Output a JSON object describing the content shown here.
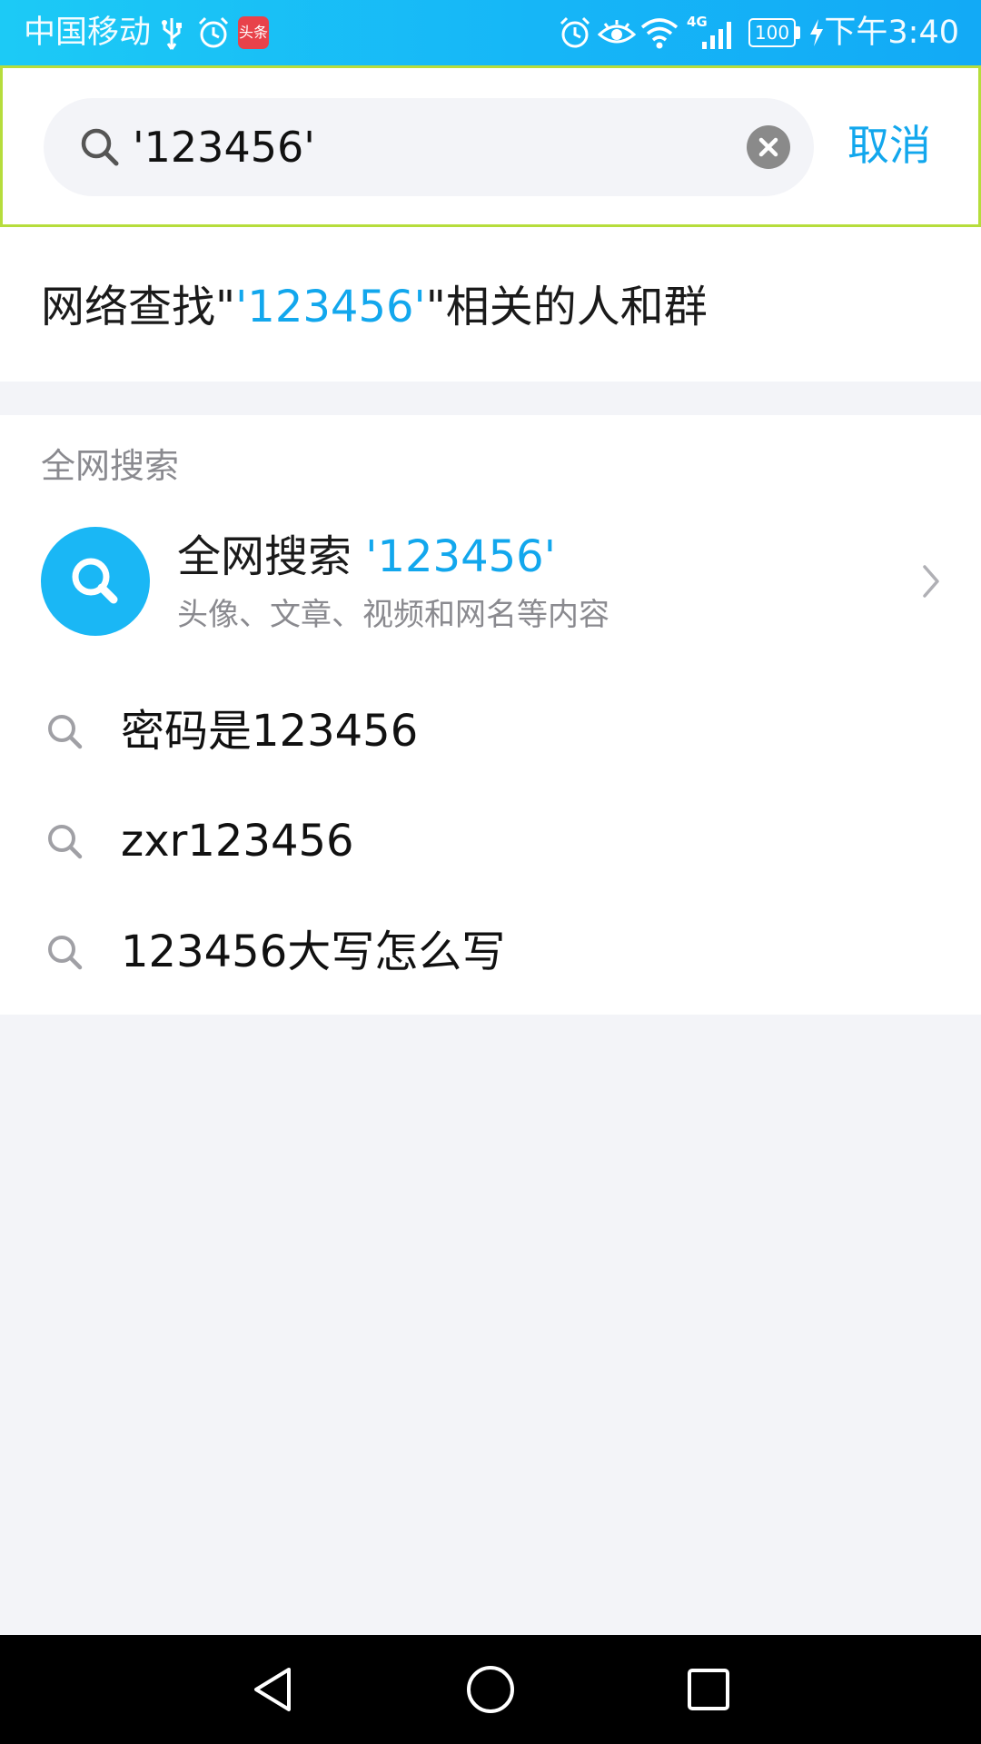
{
  "status_bar": {
    "carrier": "中国移动",
    "network_type": "4G",
    "battery": "100",
    "time": "下午3:40",
    "app_badge_text": "头条"
  },
  "search": {
    "query": "'123456'",
    "cancel_label": "取消"
  },
  "network_find": {
    "prefix": "网络查找\"",
    "keyword": "'123456'",
    "suffix": "\"相关的人和群"
  },
  "web_search": {
    "section_label": "全网搜索",
    "title": "全网搜索",
    "keyword": "'123456'",
    "subtitle": "头像、文章、视频和网名等内容"
  },
  "suggestions": [
    "密码是123456",
    "zxr123456",
    "123456大写怎么写"
  ],
  "colors": {
    "accent": "#12a7ed",
    "status_bar": "#16b6f7",
    "web_search_avatar": "#1ab7f5",
    "page_background": "#f3f4f8"
  },
  "icons": {
    "search": "search-icon",
    "clear": "clear-icon",
    "chevron": "chevron-right-icon",
    "nav_back": "back-triangle-icon",
    "nav_home": "home-circle-icon",
    "nav_recents": "recents-square-icon"
  }
}
